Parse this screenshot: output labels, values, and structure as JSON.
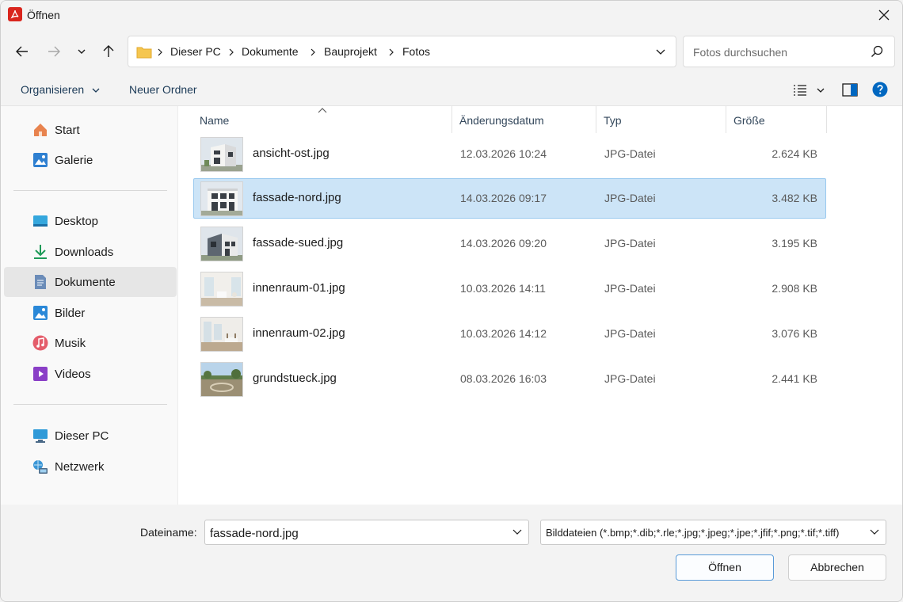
{
  "window": {
    "title": "Öffnen"
  },
  "breadcrumb": [
    "Dieser PC",
    "Dokumente",
    "Bauprojekt",
    "Fotos"
  ],
  "search": {
    "placeholder": "Fotos durchsuchen"
  },
  "toolbar": {
    "organize": "Organisieren",
    "new_folder": "Neuer Ordner"
  },
  "sidebar": {
    "group1": [
      {
        "label": "Start",
        "icon": "home-icon"
      },
      {
        "label": "Galerie",
        "icon": "gallery-icon"
      }
    ],
    "group2": [
      {
        "label": "Desktop",
        "icon": "desktop-icon"
      },
      {
        "label": "Downloads",
        "icon": "download-icon"
      },
      {
        "label": "Dokumente",
        "icon": "document-icon",
        "active": true
      },
      {
        "label": "Bilder",
        "icon": "pictures-icon"
      },
      {
        "label": "Musik",
        "icon": "music-icon"
      },
      {
        "label": "Videos",
        "icon": "video-icon"
      }
    ],
    "group3": [
      {
        "label": "Dieser PC",
        "icon": "pc-icon"
      },
      {
        "label": "Netzwerk",
        "icon": "network-icon"
      }
    ]
  },
  "columns": {
    "name": "Name",
    "date": "Änderungsdatum",
    "type": "Typ",
    "size": "Größe"
  },
  "files": [
    {
      "name": "ansicht-ost.jpg",
      "date": "12.03.2026 10:24",
      "type": "JPG-Datei",
      "size": "2.624 KB",
      "thumb": "house"
    },
    {
      "name": "fassade-nord.jpg",
      "date": "14.03.2026 09:17",
      "type": "JPG-Datei",
      "size": "3.482 KB",
      "thumb": "house",
      "selected": true
    },
    {
      "name": "fassade-sued.jpg",
      "date": "14.03.2026 09:20",
      "type": "JPG-Datei",
      "size": "3.195 KB",
      "thumb": "house-dark"
    },
    {
      "name": "innenraum-01.jpg",
      "date": "10.03.2026 14:11",
      "type": "JPG-Datei",
      "size": "2.908 KB",
      "thumb": "interior"
    },
    {
      "name": "innenraum-02.jpg",
      "date": "10.03.2026 14:12",
      "type": "JPG-Datei",
      "size": "3.076 KB",
      "thumb": "interior"
    },
    {
      "name": "grundstueck.jpg",
      "date": "08.03.2026 16:03",
      "type": "JPG-Datei",
      "size": "2.441 KB",
      "thumb": "site"
    }
  ],
  "footer": {
    "filename_label": "Dateiname:",
    "filename_value": "fassade-nord.jpg",
    "filter": "Bilddateien (*.bmp;*.dib;*.rle;*.jpg;*.jpeg;*.jpe;*.jfif;*.png;*.tif;*.tiff)",
    "open": "Öffnen",
    "cancel": "Abbrechen"
  },
  "colors": {
    "accent": "#0067c0",
    "selection": "#cce4f7",
    "pdf_red": "#d9251d"
  }
}
